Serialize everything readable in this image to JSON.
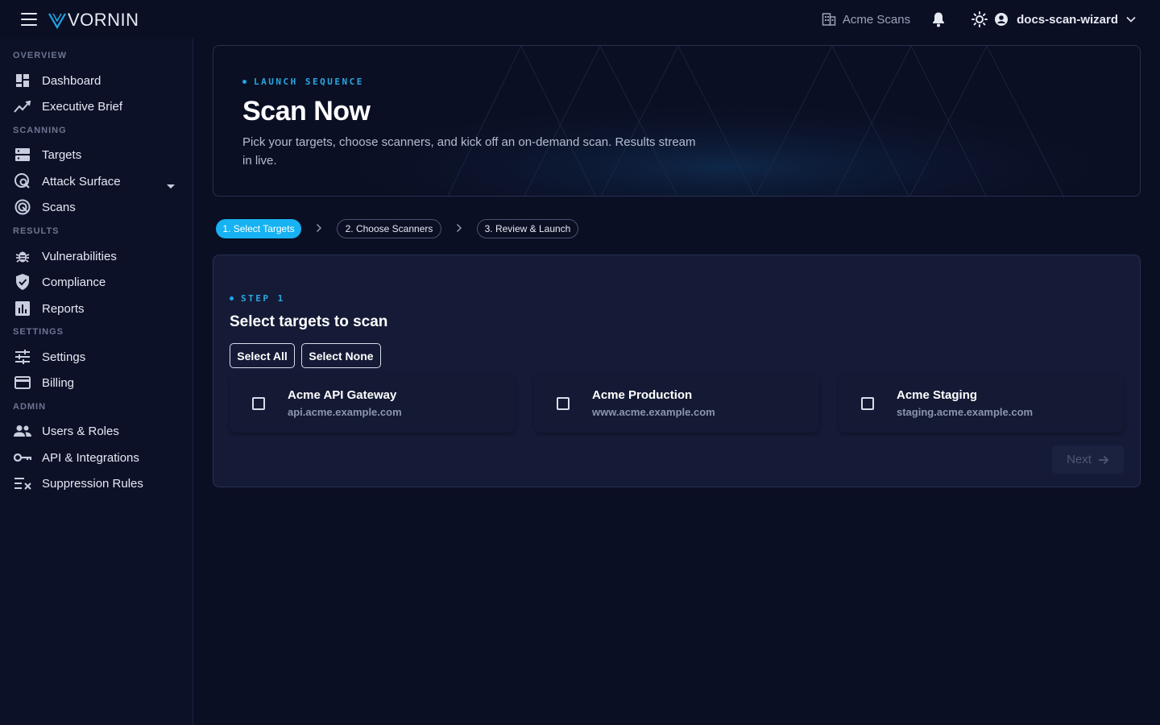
{
  "brand": {
    "name": "VORNIN"
  },
  "header": {
    "org_name": "Acme Scans",
    "username": "docs-scan-wizard"
  },
  "sidebar": {
    "sections": [
      {
        "label": "OVERVIEW",
        "items": [
          {
            "label": "Dashboard",
            "icon": "dashboard-icon"
          },
          {
            "label": "Executive Brief",
            "icon": "trend-icon"
          }
        ]
      },
      {
        "label": "SCANNING",
        "items": [
          {
            "label": "Targets",
            "icon": "server-icon"
          },
          {
            "label": "Attack Surface",
            "icon": "radar-search-icon"
          },
          {
            "label": "Scans",
            "icon": "radar-icon"
          }
        ]
      },
      {
        "label": "RESULTS",
        "items": [
          {
            "label": "Vulnerabilities",
            "icon": "bug-icon"
          },
          {
            "label": "Compliance",
            "icon": "shield-check-icon"
          },
          {
            "label": "Reports",
            "icon": "bar-chart-icon"
          }
        ]
      },
      {
        "label": "SETTINGS",
        "items": [
          {
            "label": "Settings",
            "icon": "sliders-icon"
          },
          {
            "label": "Billing",
            "icon": "credit-card-icon"
          }
        ]
      },
      {
        "label": "ADMIN",
        "items": [
          {
            "label": "Users & Roles",
            "icon": "users-icon"
          },
          {
            "label": "API & Integrations",
            "icon": "key-icon"
          },
          {
            "label": "Suppression Rules",
            "icon": "list-x-icon"
          }
        ]
      }
    ]
  },
  "hero": {
    "eyebrow": "LAUNCH SEQUENCE",
    "title": "Scan Now",
    "description": "Pick your targets, choose scanners, and kick off an on-demand scan. Results stream in live."
  },
  "stepper": {
    "steps": [
      "1. Select Targets",
      "2. Choose Scanners",
      "3. Review & Launch"
    ],
    "active_index": 0
  },
  "step_card": {
    "eyebrow": "STEP 1",
    "title": "Select targets to scan",
    "select_all_label": "Select All",
    "select_none_label": "Select None",
    "targets": [
      {
        "name": "Acme API Gateway",
        "host": "api.acme.example.com",
        "checked": false
      },
      {
        "name": "Acme Production",
        "host": "www.acme.example.com",
        "checked": false
      },
      {
        "name": "Acme Staging",
        "host": "staging.acme.example.com",
        "checked": false
      }
    ],
    "next_label": "Next",
    "next_enabled": false
  },
  "colors": {
    "accent": "#16b2f2",
    "background": "#0b0f24",
    "card": "#151b37"
  }
}
